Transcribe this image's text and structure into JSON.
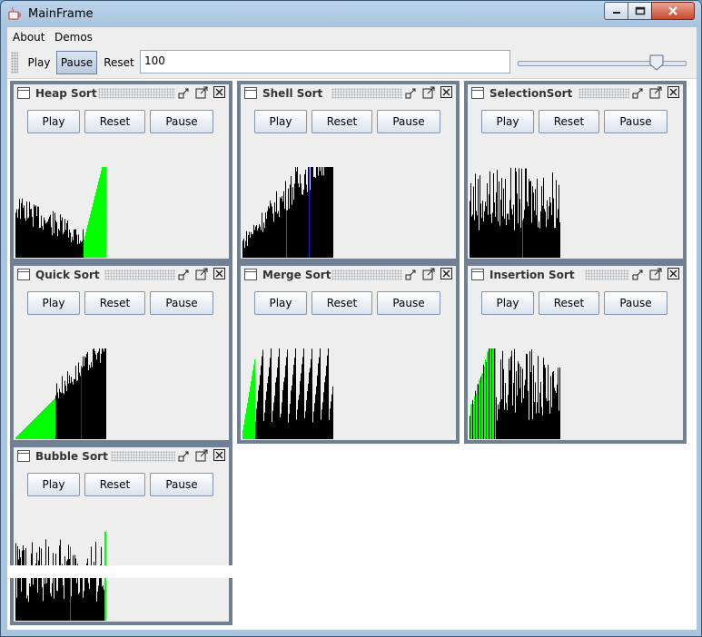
{
  "window": {
    "title": "MainFrame"
  },
  "menu": {
    "items": [
      "About",
      "Demos"
    ]
  },
  "toolbar": {
    "play_label": "Play",
    "pause_label": "Pause",
    "reset_label": "Reset",
    "input_value": "100",
    "slider_value_fraction": 0.83
  },
  "frames": [
    {
      "title": "Heap Sort",
      "play": "Play",
      "reset": "Reset",
      "pause": "Pause"
    },
    {
      "title": "Shell Sort",
      "play": "Play",
      "reset": "Reset",
      "pause": "Pause"
    },
    {
      "title": "SelectionSort",
      "play": "Play",
      "reset": "Reset",
      "pause": "Pause"
    },
    {
      "title": "Quick Sort",
      "play": "Play",
      "reset": "Reset",
      "pause": "Pause"
    },
    {
      "title": "Merge Sort",
      "play": "Play",
      "reset": "Reset",
      "pause": "Pause"
    },
    {
      "title": "Insertion Sort",
      "play": "Play",
      "reset": "Reset",
      "pause": "Pause"
    },
    {
      "title": "Bubble Sort",
      "play": "Play",
      "reset": "Reset",
      "pause": "Pause"
    }
  ],
  "colors": {
    "bar": "#000000",
    "sorted": "#00ff00",
    "compare": "#cc2222",
    "pivot": "#2222cc",
    "frame_border": "#6f8095",
    "panel": "#eeeeee"
  },
  "icons": [
    "java-icon",
    "minimize-icon",
    "maximize-icon",
    "close-icon",
    "frame-icon",
    "iconify-icon",
    "frame-maximize-icon",
    "frame-close-icon"
  ]
}
